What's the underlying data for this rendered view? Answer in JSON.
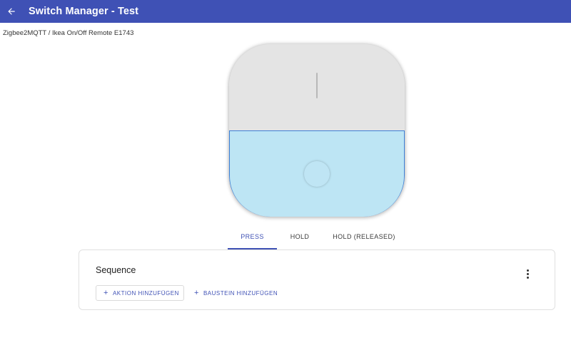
{
  "app": {
    "title": "Switch Manager - Test",
    "header_color": "#3f51b5"
  },
  "breadcrumb": "Zigbee2MQTT / Ikea On/Off Remote E1743",
  "remote": {
    "selected_button": "bottom",
    "selected_fill": "#bde5f4",
    "selected_border": "#3d7fd6"
  },
  "tabs": [
    {
      "label": "PRESS",
      "active": true
    },
    {
      "label": "HOLD",
      "active": false
    },
    {
      "label": "HOLD (RELEASED)",
      "active": false
    }
  ],
  "sequence": {
    "title": "Sequence",
    "add_action_label": "AKTION HINZUFÜGEN",
    "add_block_label": "BAUSTEIN HINZUFÜGEN",
    "plus_glyph": "+",
    "menu_icon": "more-vert-icon"
  }
}
